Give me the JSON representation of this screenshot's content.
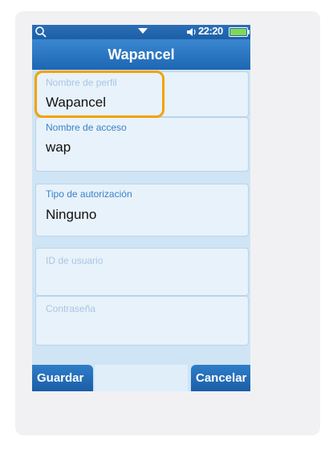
{
  "statusbar": {
    "time": "22:20",
    "icons": [
      "search-icon",
      "chevron-down-icon",
      "volume-icon",
      "battery-icon"
    ]
  },
  "header": {
    "title": "Wapancel"
  },
  "fields": [
    {
      "label": "Nombre de perfil",
      "value": "Wapancel",
      "state": "dimmed-label"
    },
    {
      "label": "Nombre de acceso",
      "value": "wap"
    },
    {
      "label": "Tipo de autorización",
      "value": "Ninguno"
    },
    {
      "label": "ID de usuario",
      "value": "",
      "state": "disabled"
    },
    {
      "label": "Contraseña",
      "value": "",
      "state": "disabled"
    }
  ],
  "softkeys": {
    "left": "Guardar",
    "right": "Cancelar"
  },
  "colors": {
    "accent": "#1e66b3",
    "background": "#cfe4f4",
    "highlight": "#f2a200"
  }
}
